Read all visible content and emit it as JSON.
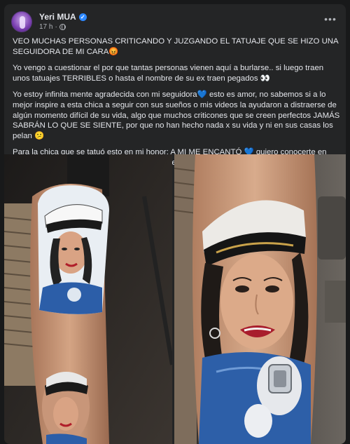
{
  "post": {
    "author": "Yeri MUA",
    "timestamp": "17 h",
    "paragraphs": [
      "VEO MUCHAS PERSONAS CRITICANDO Y JUZGANDO EL TATUAJE QUE SE HIZO UNA SEGUIDORA DE MI CARA😡",
      "Yo vengo a cuestionar el por que tantas personas vienen aquí a burlarse.. si luego traen unos tatuajes TERRIBLES o hasta el nombre de su ex traen pegados 👀",
      "Yo estoy infinita mente agradecida con mi seguidora💙 esto es amor, no sabemos si a lo mejor inspire a esta chica a seguir con sus sueños o mis videos la ayudaron a distraerse de algún momento difícil de su vida, algo que muchos criticones que se creen perfectos JAMÁS SABRÁN LO QUE SE SIENTE, por que no han hecho nada x su vida y ni en sus casas los pelan 😕",
      "Para la chica que se tatuó esto en mi honor: A MI ME ENCANTÓ 💙 quiero conocerte en persona! Ojalá puedas ver esto y ponernos de acuerdo🙏"
    ]
  },
  "colors": {
    "background": "#18191a",
    "card": "#242526",
    "text_primary": "#e4e6eb",
    "text_secondary": "#b0b3b8",
    "verified_badge": "#2d88ff"
  },
  "icons": [
    "avatar",
    "verified-badge-icon",
    "globe-icon",
    "more-options-icon"
  ]
}
